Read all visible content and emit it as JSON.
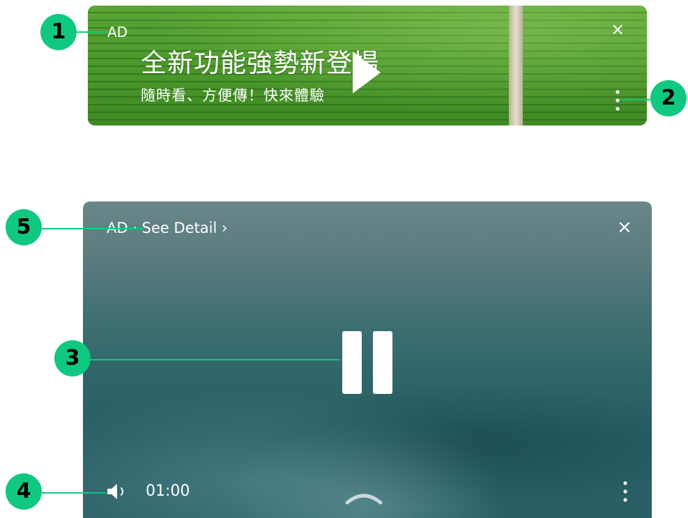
{
  "banner_ad": {
    "ad_label": "AD",
    "headline": "全新功能強勢新登場",
    "subline": "隨時看、方便傳！快來體驗",
    "close_glyph": "×",
    "play_icon": "play-icon",
    "more_icon": "more-vertical-icon"
  },
  "video_ad": {
    "ad_text": "AD · See Detail ›",
    "close_glyph": "×",
    "pause_icon": "pause-icon",
    "volume_icon": "volume-icon",
    "time": "01:00",
    "expand_icon": "chevron-up-icon",
    "more_icon": "more-vertical-icon"
  },
  "callouts": [
    "1",
    "2",
    "3",
    "4",
    "5"
  ],
  "colors": {
    "callout": "#10c87f",
    "banner_green": "#4d9a2c",
    "video_teal": "#2f6669"
  }
}
